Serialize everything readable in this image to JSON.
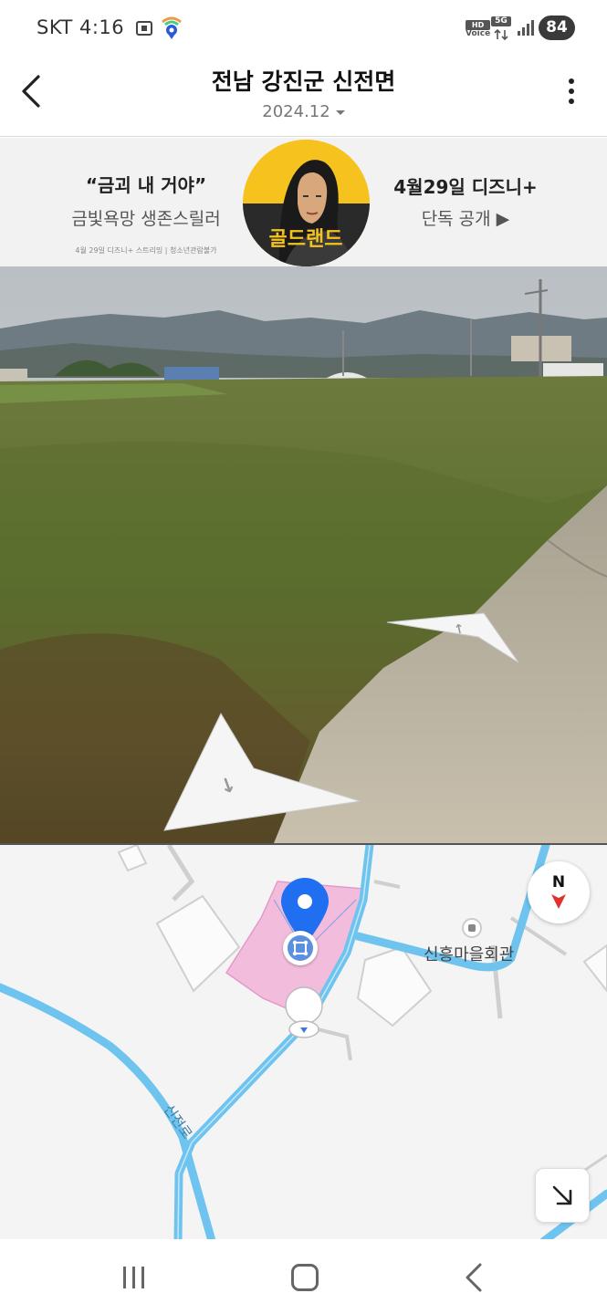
{
  "status_bar": {
    "carrier_time": "SKT 4:16",
    "hd_label": "HD",
    "voice_label": "Voice",
    "network_label": "5G",
    "battery": "84"
  },
  "header": {
    "title": "전남 강진군 신전면",
    "date": "2024.12"
  },
  "ad": {
    "quote": "“금괴 내 거야”",
    "subtitle": "금빛욕망 생존스릴러",
    "fine_print": "4월 29일 디즈니+ 스트리밍 | 청소년관람불가",
    "release": "4월29일 디즈니+",
    "cta": "단독 공개 ▶",
    "poster_title": "골드랜드"
  },
  "map": {
    "poi_name": "신흥마을회관",
    "road_name": "신전로",
    "compass_label": "N"
  },
  "colors": {
    "pin_blue": "#1f6ff0",
    "road_blue": "#6ec4ef",
    "area_pink": "#f2b8da",
    "compass_red": "#e23030"
  },
  "icons": {
    "back": "chevron-left-icon",
    "more": "more-vertical-icon",
    "expand": "arrow-down-right-icon",
    "nav_recent": "recent-apps-icon",
    "nav_home": "home-icon",
    "nav_back": "back-icon"
  }
}
